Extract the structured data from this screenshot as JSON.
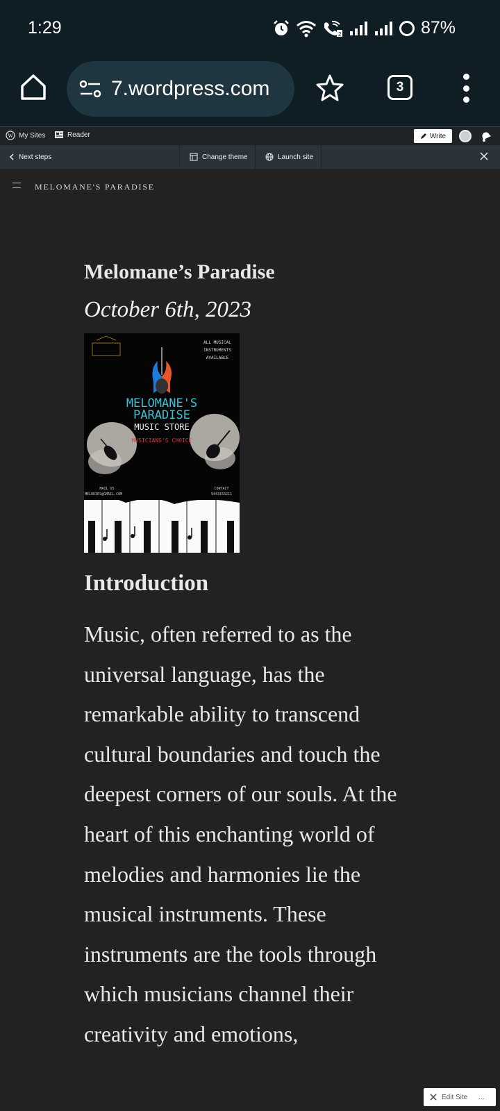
{
  "status_bar": {
    "time": "1:29",
    "battery": "87%",
    "icons": [
      "alarm-icon",
      "wifi-icon",
      "wifi-calling-icon",
      "signal-icon",
      "signal-icon",
      "battery-icon"
    ]
  },
  "browser": {
    "url": "7.wordpress.com",
    "tab_count": "3"
  },
  "wp_admin_bar": {
    "my_sites": "My Sites",
    "reader": "Reader",
    "write": "Write"
  },
  "launchpad": {
    "next_steps": "Next steps",
    "change_theme": "Change theme",
    "launch_site": "Launch site"
  },
  "site": {
    "name": "MELOMANE'S PARADISE"
  },
  "post": {
    "title": "Melomane’s Paradise",
    "date": "October 6th, 2023",
    "poster": {
      "top_right": "ALL MUSICAL INSTRUMENTS AVAILABLE",
      "store_name_1": "MELOMANE'S",
      "store_name_2": "PARADISE",
      "store_subtitle": "MUSIC STORE",
      "tagline": "MUSICIANS'S CHOICE",
      "mail_label": "MAIL US",
      "mail_value": "MELODIES@GMAIL.COM",
      "contact_label": "CONTACT",
      "contact_value": "9443156211"
    },
    "section_heading": "Introduction",
    "body": "Music, often referred to as the universal language, has the remarkable ability to transcend cultural boundaries and touch the deepest corners of our souls. At the heart of this enchanting world of melodies and harmonies lie the musical instruments. These instruments are the tools through which musicians channel their creativity and emotions,"
  },
  "edit_site": {
    "label": "Edit Site",
    "more": "..."
  },
  "colors": {
    "status_bg": "#0f1d24",
    "url_pill": "#1f3540",
    "wp_bar": "#1d2327",
    "launch_bar": "#2c3338",
    "page_bg": "#222223",
    "text": "#e8e8e8"
  }
}
